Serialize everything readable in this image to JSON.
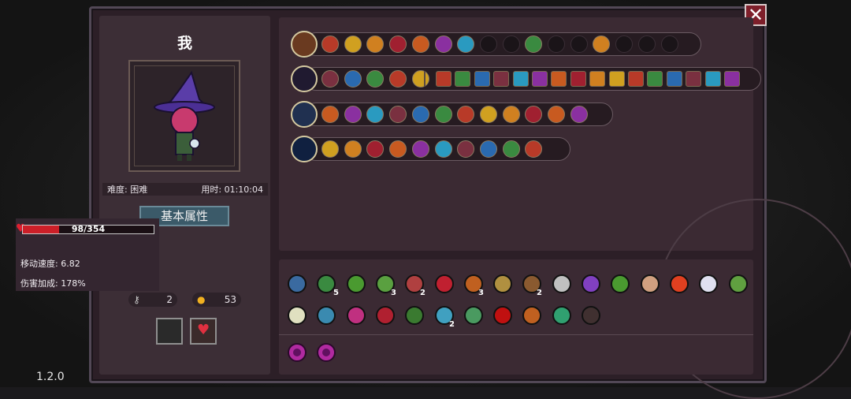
{
  "version": "1.2.0",
  "player": {
    "name": "我",
    "difficulty_label": "难度: 困难",
    "time_label": "用时: 01:10:04",
    "section_title": "基本属性",
    "hp_text": "98/354",
    "hp_fraction": 0.277,
    "move_speed": "移动速度: 6.82",
    "damage_bonus": "伤害加成: 178%",
    "keys": "2",
    "coins": "53"
  },
  "colors": {
    "accent_red": "#cc1f28",
    "title_bg": "#3b5a69",
    "panel": "#3b2a33"
  },
  "weapon_rows": [
    {
      "weapon_icon": "treasure-chest-icon",
      "skills": [
        "target-icon",
        "wave-icon",
        "flame-arrow-icon",
        "lightning-icon",
        "rune-icon",
        "purple-flame-icon",
        "dash-icon",
        "empty",
        "empty",
        "eye-icon",
        "empty",
        "empty",
        "sword-icon",
        "empty",
        "empty",
        "empty"
      ]
    },
    {
      "weapon_icon": "dark-staff-icon",
      "skills": [
        "skull-icon",
        "leaf-icon",
        "star-icon",
        "book-icon",
        "meat-icon"
      ]
    },
    {
      "weapon_icon": "ice-staff-icon",
      "skills": [
        "hourglass-icon",
        "flame-arrow-icon",
        "dice-icon",
        "meat-icon",
        "arrow-up-icon",
        "arrow-up-icon",
        "spin-icon",
        "meat-icon",
        "chest-icon",
        "arrow-up-icon",
        "purple-wave-icon",
        "sword-icon"
      ]
    },
    {
      "weapon_icon": "blue-sword-icon",
      "skills": [
        "skull-icon",
        "blue-star-icon",
        "arrow-up-icon",
        "flame-arrow-icon",
        "spin-icon",
        "meat-icon",
        "flame-arrow-icon",
        "blue-wave-icon",
        "blue-wave-icon",
        "feather-icon"
      ]
    }
  ],
  "relic_counts": [
    "5",
    "3",
    "2",
    "3",
    "2",
    "2"
  ]
}
